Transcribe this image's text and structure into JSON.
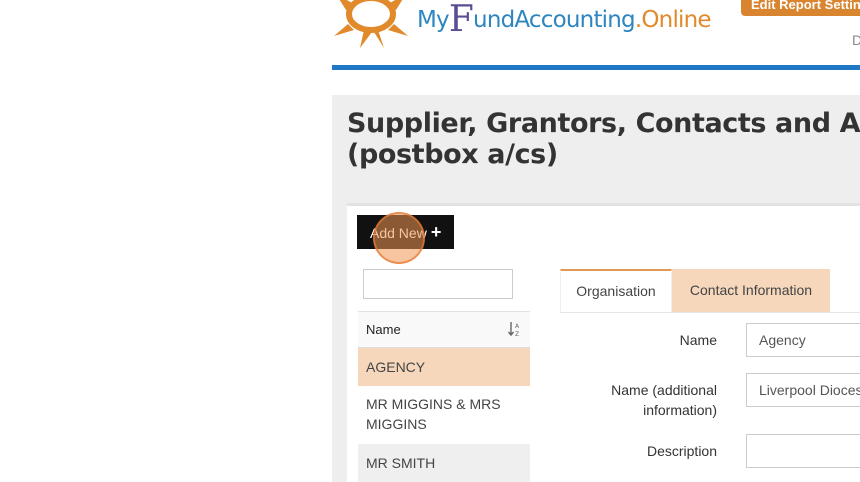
{
  "header": {
    "logo": {
      "my": "My",
      "f": "F",
      "fund": "und",
      "accounting": "Accounting",
      "dot": ".",
      "online": "Online"
    },
    "report_button_label": "Edit Report Settings",
    "right_glyph": "D"
  },
  "page": {
    "title_line1": "Supplier, Grantors, Contacts and Agencies",
    "title_line2": "(postbox a/cs)"
  },
  "toolbar": {
    "add_new_label": "Add New",
    "add_new_icon": "plus-icon"
  },
  "search": {
    "value": "",
    "placeholder": ""
  },
  "list": {
    "column_header": "Name",
    "sort_icon": "sort-alpha-icon",
    "items": [
      {
        "label": "AGENCY",
        "selected": true
      },
      {
        "label": "MR MIGGINS & MRS MIGGINS",
        "line1": "MR MIGGINS & MRS",
        "line2": "MIGGINS",
        "selected": false
      },
      {
        "label": "MR SMITH",
        "selected": false
      }
    ]
  },
  "tabs": [
    {
      "label": "Organisation",
      "active": true
    },
    {
      "label": "Contact Information",
      "active": false
    }
  ],
  "form": {
    "name_label": "Name",
    "name_value": "Agency",
    "name_additional_label_line1": "Name (additional",
    "name_additional_label_line2": "information)",
    "name_additional_value": "Liverpool Diocese",
    "description_label": "Description",
    "description_value": ""
  },
  "colors": {
    "brand_blue": "#1f77c5",
    "brand_orange": "#d9852f",
    "selected_row": "#f6d7bc",
    "panel_bg": "#efeeee"
  }
}
